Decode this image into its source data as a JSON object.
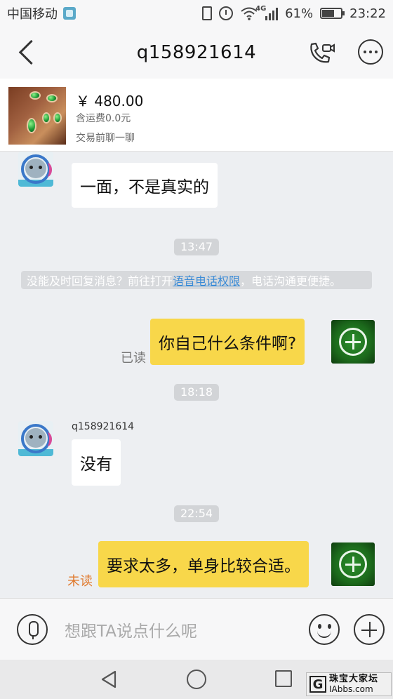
{
  "status_bar": {
    "carrier": "中国移动",
    "network": "4G",
    "battery_percent": "61%",
    "battery_level": 0.61,
    "time": "23:22"
  },
  "header": {
    "title": "q158921614"
  },
  "product": {
    "price": "￥ 480.00",
    "shipping": "含运费0.0元",
    "hint": "交易前聊一聊"
  },
  "messages": [
    {
      "id": "m1",
      "from": "other",
      "text": "一面，不是真实的"
    },
    {
      "id": "t1",
      "type": "time",
      "text": "13:47"
    },
    {
      "id": "n1",
      "type": "notice",
      "text_before": "没能及时回复消息？前往打开",
      "link": "语音电话权限",
      "text_after": "，电话沟通更便捷。"
    },
    {
      "id": "m2",
      "from": "me",
      "text": "你自己什么条件啊?",
      "status": "已读"
    },
    {
      "id": "t2",
      "type": "time",
      "text": "18:18"
    },
    {
      "id": "m3",
      "from": "other",
      "sender": "q158921614",
      "text": "没有"
    },
    {
      "id": "t3",
      "type": "time",
      "text": "22:54"
    },
    {
      "id": "m4",
      "from": "me",
      "text": "要求太多，单身比较合适。",
      "status": "未读"
    }
  ],
  "input": {
    "placeholder": "想跟TA说点什么呢"
  },
  "watermark": {
    "name": "珠宝大家坛",
    "site": "IAbbs.com",
    "letter": "G"
  },
  "colors": {
    "outgoing_bubble": "#f8d74a",
    "incoming_bubble": "#ffffff",
    "unread": "#e07a2e",
    "link": "#3b8bd6"
  }
}
